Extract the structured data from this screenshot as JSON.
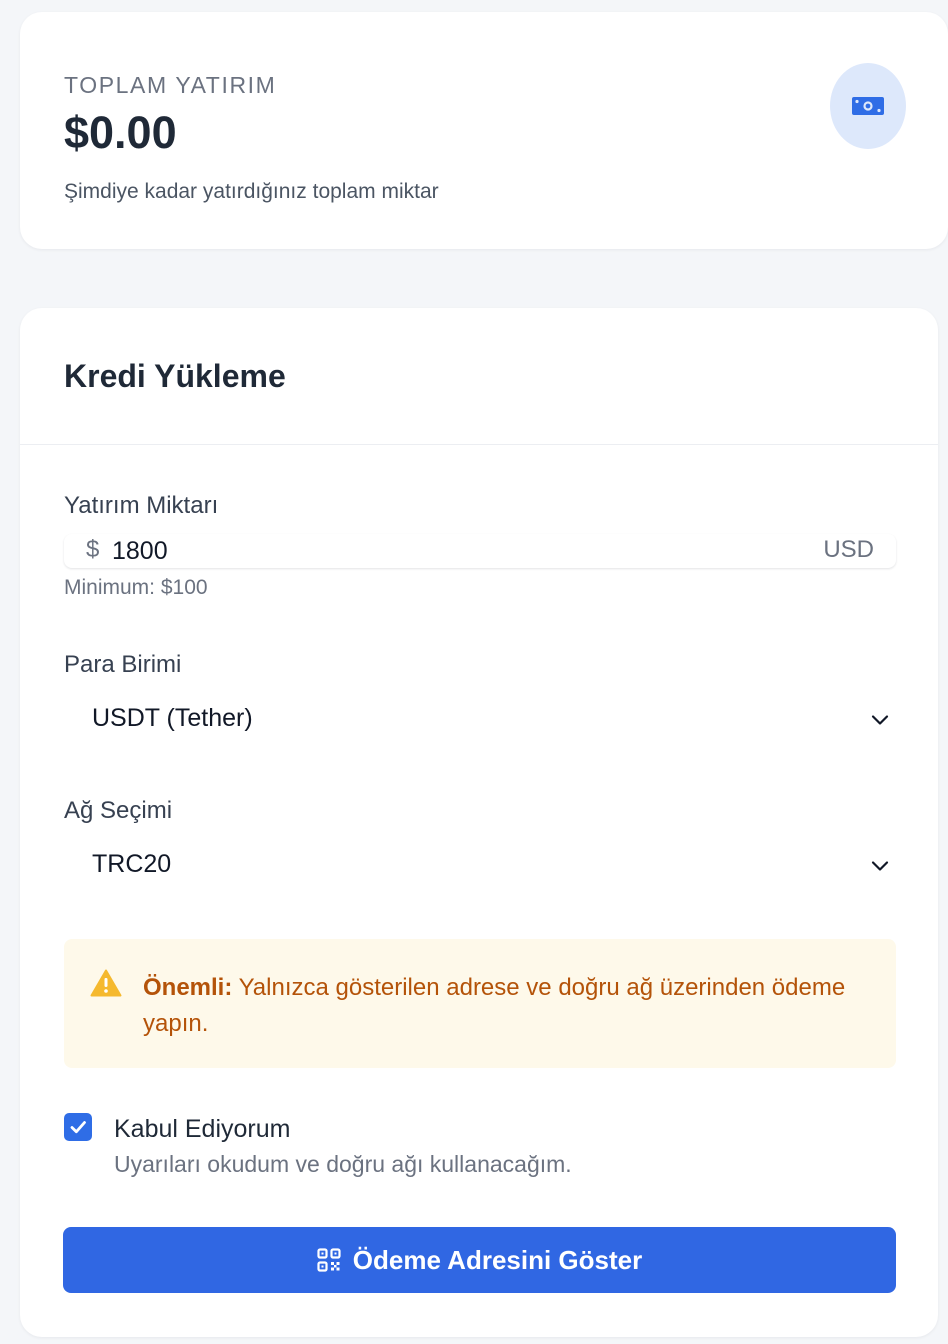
{
  "summary": {
    "title": "TOPLAM YATIRIM",
    "amount": "$0.00",
    "description": "Şimdiye kadar yatırdığınız toplam miktar",
    "icon": "money-bill-icon"
  },
  "form": {
    "title": "Kredi Yükleme",
    "amount": {
      "label": "Yatırım Miktarı",
      "currency_symbol": "$",
      "value": "1800",
      "currency_code": "USD",
      "hint": "Minimum: $100"
    },
    "currency": {
      "label": "Para Birimi",
      "selected": "USDT (Tether)"
    },
    "network": {
      "label": "Ağ Seçimi",
      "selected": "TRC20"
    },
    "warning": {
      "strong": "Önemli:",
      "text": " Yalnızca gösterilen adrese ve doğru ağ üzerinden ödeme yapın."
    },
    "agreement": {
      "checked": true,
      "label": "Kabul Ediyorum",
      "description": "Uyarıları okudum ve doğru ağı kullanacağım."
    },
    "submit_label": "Ödeme Adresini Göster"
  },
  "colors": {
    "accent": "#3067e3",
    "warning_bg": "#fef9ea",
    "warning_text": "#b45309",
    "warning_icon": "#f5b92e",
    "badge_bg": "#dde8fb"
  }
}
